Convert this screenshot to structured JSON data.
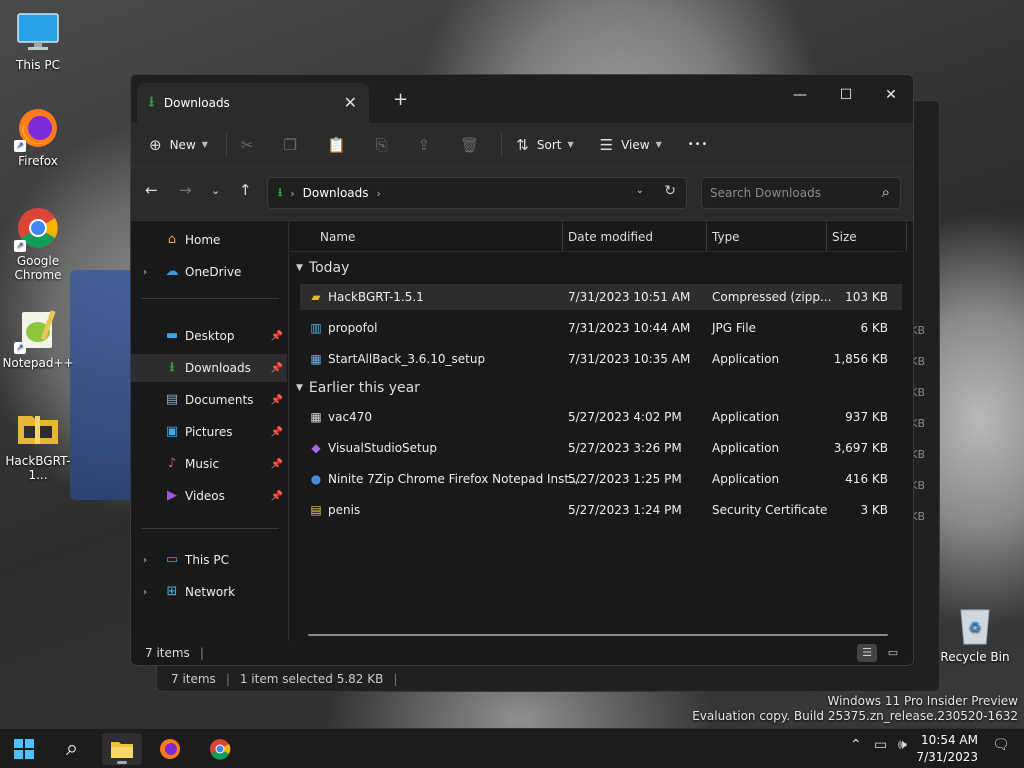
{
  "desktop": {
    "icons": [
      {
        "label": "This PC"
      },
      {
        "label": "Firefox"
      },
      {
        "label": "Google Chrome"
      },
      {
        "label": "Notepad++"
      },
      {
        "label": "HackBGRT-1..."
      },
      {
        "label": "Recycle Bin"
      }
    ]
  },
  "ghost_window": {
    "status_items": "7 items",
    "status_selected": "1 item selected  5.82 KB",
    "sizes": [
      "KB",
      "KB",
      "KB",
      "KB",
      "KB",
      "KB",
      "KB"
    ]
  },
  "window": {
    "tab_title": "Downloads",
    "tab_close": "✕",
    "new_tab": "+",
    "controls": {
      "minimize": "—",
      "maximize": "☐",
      "close": "✕"
    }
  },
  "command_bar": {
    "new_label": "New",
    "sort_label": "Sort",
    "view_label": "View",
    "more_label": "•••"
  },
  "address": {
    "location": "Downloads",
    "search_placeholder": "Search Downloads"
  },
  "sidebar": {
    "items": [
      {
        "label": "Home"
      },
      {
        "label": "OneDrive"
      },
      {
        "label": "Desktop"
      },
      {
        "label": "Downloads"
      },
      {
        "label": "Documents"
      },
      {
        "label": "Pictures"
      },
      {
        "label": "Music"
      },
      {
        "label": "Videos"
      },
      {
        "label": "This PC"
      },
      {
        "label": "Network"
      }
    ]
  },
  "columns": {
    "name": "Name",
    "date": "Date modified",
    "type": "Type",
    "size": "Size"
  },
  "groups": {
    "today": "Today",
    "earlier": "Earlier this year"
  },
  "files": [
    {
      "name": "HackBGRT-1.5.1",
      "date": "7/31/2023 10:51 AM",
      "type": "Compressed (zipp...",
      "size": "103 KB"
    },
    {
      "name": "propofol",
      "date": "7/31/2023 10:44 AM",
      "type": "JPG File",
      "size": "6 KB"
    },
    {
      "name": "StartAllBack_3.6.10_setup",
      "date": "7/31/2023 10:35 AM",
      "type": "Application",
      "size": "1,856 KB"
    },
    {
      "name": "vac470",
      "date": "5/27/2023 4:02 PM",
      "type": "Application",
      "size": "937 KB"
    },
    {
      "name": "VisualStudioSetup",
      "date": "5/27/2023 3:26 PM",
      "type": "Application",
      "size": "3,697 KB"
    },
    {
      "name": "Ninite 7Zip Chrome Firefox Notepad Inst...",
      "date": "5/27/2023 1:25 PM",
      "type": "Application",
      "size": "416 KB"
    },
    {
      "name": "penis",
      "date": "5/27/2023 1:24 PM",
      "type": "Security Certificate",
      "size": "3 KB"
    }
  ],
  "status": {
    "items": "7 items"
  },
  "watermark": {
    "line1": "Windows 11 Pro Insider Preview",
    "line2": "Evaluation copy. Build 25375.zn_release.230520-1632"
  },
  "taskbar": {
    "time": "10:54 AM",
    "date": "7/31/2023"
  },
  "colors": {
    "accent": "#2ea043",
    "window_bg": "#191919",
    "taskbar_bg": "#1c1c1c"
  }
}
